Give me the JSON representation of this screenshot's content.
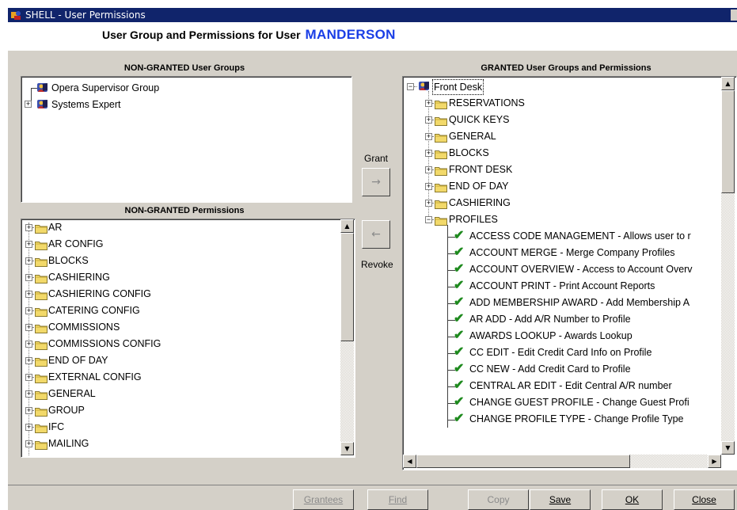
{
  "window": {
    "title": "SHELL - User Permissions"
  },
  "header": {
    "heading": "User Group and Permissions for User",
    "username": "MANDERSON"
  },
  "non_granted_groups": {
    "title": "NON-GRANTED User Groups",
    "items": [
      "Opera Supervisor Group",
      "Systems Expert"
    ]
  },
  "non_granted_permissions": {
    "title": "NON-GRANTED Permissions",
    "items": [
      "AR",
      "AR CONFIG",
      "BLOCKS",
      "CASHIERING",
      "CASHIERING CONFIG",
      "CATERING CONFIG",
      "COMMISSIONS",
      "COMMISSIONS CONFIG",
      "END OF DAY",
      "EXTERNAL CONFIG",
      "GENERAL",
      "GROUP",
      "IFC",
      "MAILING"
    ]
  },
  "granted": {
    "title": "GRANTED User Groups and Permissions",
    "root": "Front Desk",
    "folders": [
      "RESERVATIONS",
      "QUICK KEYS",
      "GENERAL",
      "BLOCKS",
      "FRONT DESK",
      "END OF DAY",
      "CASHIERING",
      "PROFILES"
    ],
    "permissions": [
      "ACCESS CODE MANAGEMENT - Allows user to r",
      "ACCOUNT MERGE - Merge Company Profiles",
      "ACCOUNT OVERVIEW - Access to Account Overv",
      "ACCOUNT PRINT - Print Account Reports",
      "ADD MEMBERSHIP AWARD - Add Membership A",
      "AR ADD - Add A/R Number to Profile",
      "AWARDS LOOKUP - Awards Lookup",
      "CC EDIT - Edit Credit Card Info on Profile",
      "CC NEW - Add Credit Card to Profile",
      "CENTRAL AR EDIT - Edit Central A/R number",
      "CHANGE GUEST PROFILE - Change Guest Profi",
      "CHANGE PROFILE TYPE - Change Profile Type"
    ]
  },
  "actions": {
    "grant": "Grant",
    "revoke": "Revoke",
    "grant_arrow": "→",
    "revoke_arrow": "←"
  },
  "buttons": {
    "grantees": "Grantees",
    "find": "Find",
    "copy": "Copy",
    "save": "Save",
    "ok": "OK",
    "close": "Close"
  },
  "colors": {
    "titlebar": "#10246b",
    "username": "#1a3ee6",
    "check": "#1e8a1e",
    "folder": "#f2d96a"
  }
}
